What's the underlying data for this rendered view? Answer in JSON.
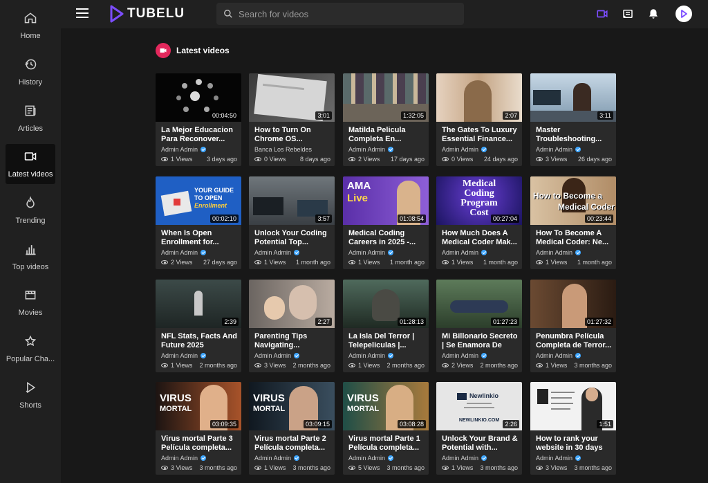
{
  "brand": {
    "name": "TUBELU"
  },
  "search": {
    "placeholder": "Search for videos"
  },
  "sidebar": {
    "items": [
      {
        "label": "Home",
        "icon": "home-icon"
      },
      {
        "label": "History",
        "icon": "history-icon"
      },
      {
        "label": "Articles",
        "icon": "articles-icon"
      },
      {
        "label": "Latest videos",
        "icon": "video-camera-icon",
        "active": true
      },
      {
        "label": "Trending",
        "icon": "flame-icon"
      },
      {
        "label": "Top videos",
        "icon": "bar-chart-icon"
      },
      {
        "label": "Movies",
        "icon": "film-icon"
      },
      {
        "label": "Popular Cha...",
        "icon": "star-icon"
      },
      {
        "label": "Shorts",
        "icon": "shorts-play-icon"
      }
    ]
  },
  "section": {
    "title": "Latest videos"
  },
  "colors": {
    "accent": "#e3285c",
    "brand": "#7c4dff",
    "verified": "#3ea6ff"
  },
  "videos": [
    {
      "title": "La Mejor Educacion Para Reconover...",
      "duration": "00:04:50",
      "channel": "Admin Admin",
      "verified": true,
      "views": "1 Views",
      "age": "3 days ago"
    },
    {
      "title": "How to Turn On Chrome OS...",
      "duration": "3:01",
      "channel": "Banca Los Rebeldes",
      "verified": false,
      "views": "0 Views",
      "age": "8 days ago"
    },
    {
      "title": "Matilda Pelicula Completa En...",
      "duration": "1:32:05",
      "channel": "Admin Admin",
      "verified": true,
      "views": "2 Views",
      "age": "17 days ago"
    },
    {
      "title": "The Gates To Luxury Essential Finance...",
      "duration": "2:07",
      "channel": "Admin Admin",
      "verified": true,
      "views": "0 Views",
      "age": "24 days ago"
    },
    {
      "title": "Master Troubleshooting...",
      "duration": "3:11",
      "channel": "Admin Admin",
      "verified": true,
      "views": "3 Views",
      "age": "26 days ago"
    },
    {
      "title": "When Is Open Enrollment for...",
      "duration": "00:02:10",
      "channel": "Admin Admin",
      "verified": true,
      "views": "2 Views",
      "age": "27 days ago",
      "overlay": [
        "YOUR GUIDE",
        "TO OPEN",
        "Enrollment"
      ]
    },
    {
      "title": "Unlock Your Coding Potential Top...",
      "duration": "3:57",
      "channel": "Admin Admin",
      "verified": true,
      "views": "1 Views",
      "age": "1 month ago"
    },
    {
      "title": "Medical Coding Careers in 2025 -...",
      "duration": "01:08:54",
      "channel": "Admin Admin",
      "verified": true,
      "views": "1 Views",
      "age": "1 month ago",
      "overlay": [
        "AMA",
        "Live"
      ]
    },
    {
      "title": "How Much Does A Medical Coder Mak...",
      "duration": "00:27:04",
      "channel": "Admin Admin",
      "verified": true,
      "views": "1 Views",
      "age": "1 month ago",
      "overlay": [
        "Medical",
        "Coding",
        "Program",
        "Cost"
      ]
    },
    {
      "title": "How To Become A Medical Coder: Ne...",
      "duration": "00:23:44",
      "channel": "Admin Admin",
      "verified": true,
      "views": "1 Views",
      "age": "1 month ago",
      "overlay": [
        "How to Become a",
        "Medical Coder"
      ]
    },
    {
      "title": "NFL Stats, Facts And Future 2025",
      "duration": "2:39",
      "channel": "Admin Admin",
      "verified": true,
      "views": "1 Views",
      "age": "2 months ago"
    },
    {
      "title": "Parenting Tips Navigating...",
      "duration": "2:27",
      "channel": "Admin Admin",
      "verified": true,
      "views": "3 Views",
      "age": "2 months ago"
    },
    {
      "title": "La Isla Del Terror | Telepeliculas |...",
      "duration": "01:28:13",
      "channel": "Admin Admin",
      "verified": true,
      "views": "1 Views",
      "age": "2 months ago"
    },
    {
      "title": "Mi Billonario Secreto | Se Enamora De Un...",
      "duration": "01:27:23",
      "channel": "Admin Admin",
      "verified": true,
      "views": "2 Views",
      "age": "2 months ago"
    },
    {
      "title": "Penumbra Película Completa de Terror...",
      "duration": "01:27:32",
      "channel": "Admin Admin",
      "verified": true,
      "views": "1 Views",
      "age": "3 months ago"
    },
    {
      "title": "Virus mortal Parte 3 Película completa...",
      "duration": "03:09:35",
      "channel": "Admin Admin",
      "verified": true,
      "views": "3 Views",
      "age": "3 months ago",
      "overlay": [
        "VIRUS",
        "MORTAL"
      ]
    },
    {
      "title": "Virus mortal Parte 2 Película completa...",
      "duration": "03:09:15",
      "channel": "Admin Admin",
      "verified": true,
      "views": "1 Views",
      "age": "3 months ago",
      "overlay": [
        "VIRUS",
        "MORTAL"
      ]
    },
    {
      "title": "Virus mortal Parte 1 Película completa...",
      "duration": "03:08:28",
      "channel": "Admin Admin",
      "verified": true,
      "views": "5 Views",
      "age": "3 months ago",
      "overlay": [
        "VIRUS",
        "MORTAL"
      ]
    },
    {
      "title": "Unlock Your Brand & Potential with...",
      "duration": "2:26",
      "channel": "Admin Admin",
      "verified": true,
      "views": "1 Views",
      "age": "3 months ago",
      "overlay": [
        "Newlinkio",
        "NEWLINKIO.COM"
      ]
    },
    {
      "title": "How to rank your website in 30 days",
      "duration": "1:51",
      "channel": "Admin Admin",
      "verified": true,
      "views": "3 Views",
      "age": "3 months ago"
    }
  ]
}
